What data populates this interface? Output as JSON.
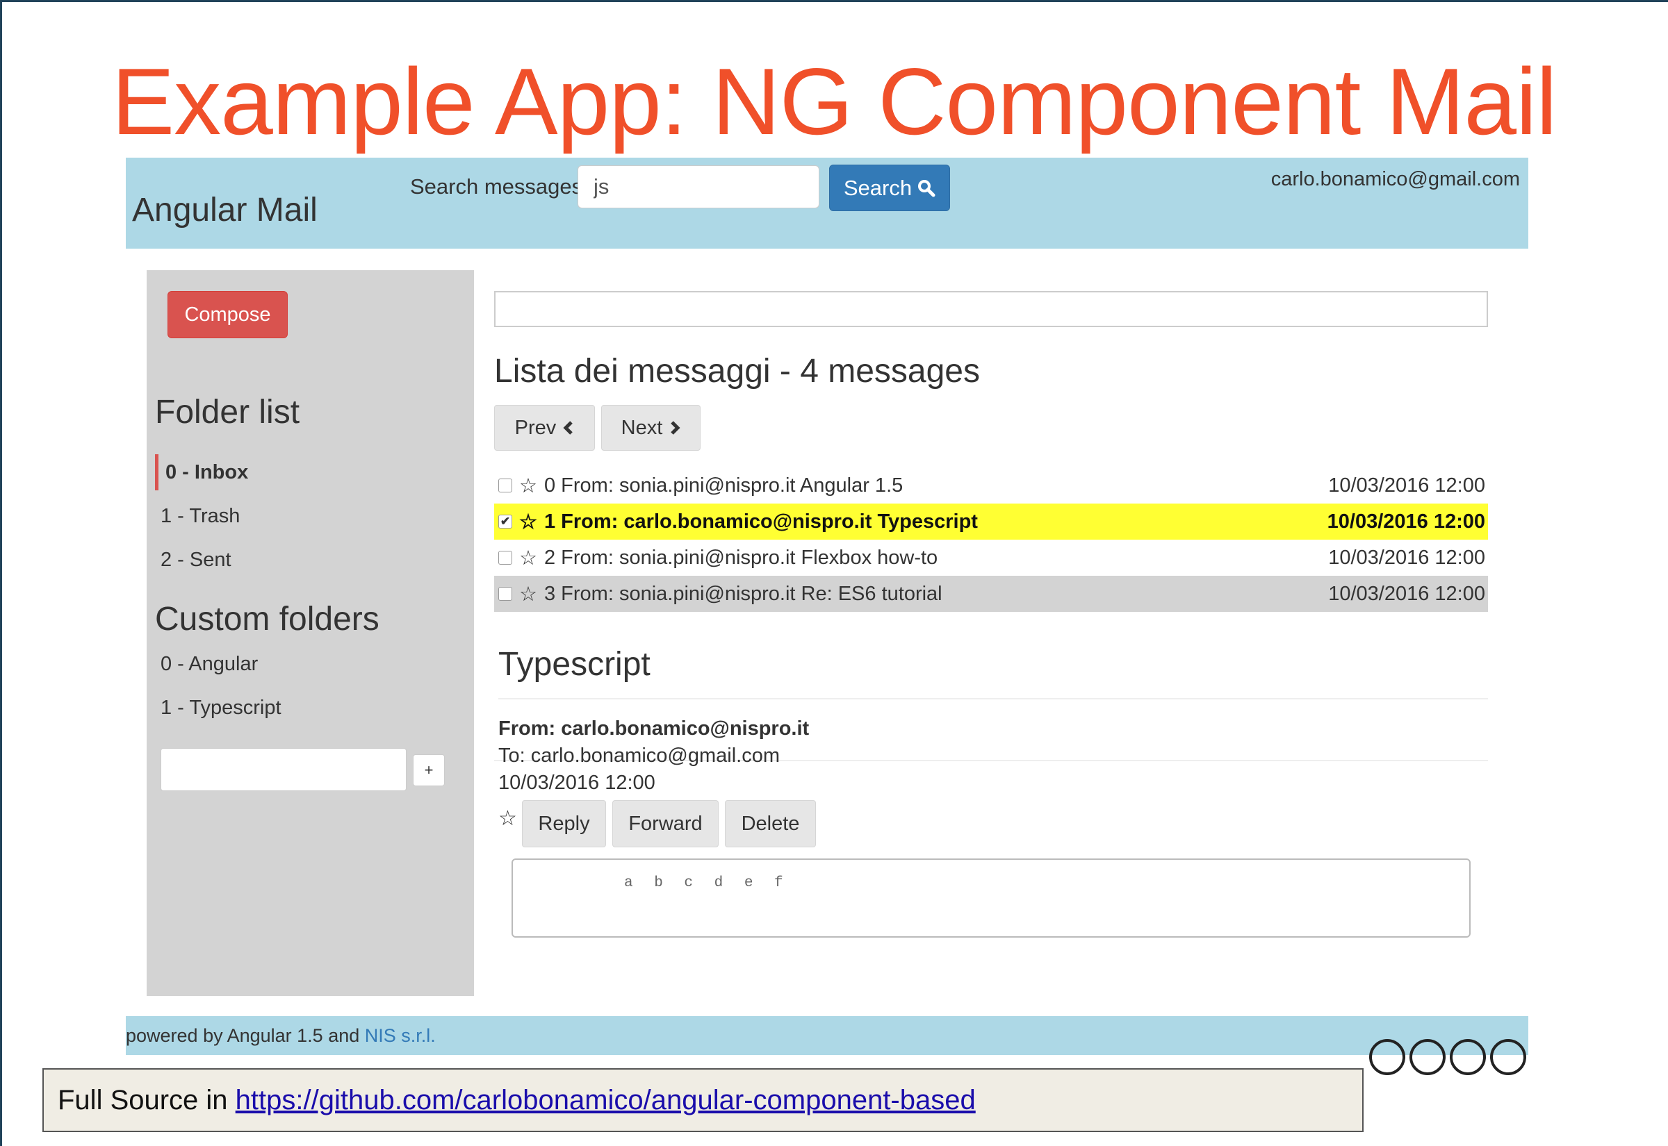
{
  "slide": {
    "title": "Example App: NG Component Mail",
    "source_prefix": "Full Source in ",
    "source_link": "https://github.com/carlobonamico/angular-component-based"
  },
  "navbar": {
    "brand": "Angular Mail",
    "search_label": "Search messages:",
    "search_value": "js",
    "search_button": "Search",
    "user_email": "carlo.bonamico@gmail.com"
  },
  "sidebar": {
    "compose_label": "Compose",
    "folder_heading": "Folder list",
    "folders": [
      {
        "label": "0 - Inbox",
        "active": true
      },
      {
        "label": "1 - Trash",
        "active": false
      },
      {
        "label": "2 - Sent",
        "active": false
      }
    ],
    "custom_heading": "Custom folders",
    "custom_folders": [
      {
        "label": "0 - Angular"
      },
      {
        "label": "1 - Typescript"
      }
    ],
    "add_folder_label": "+"
  },
  "list": {
    "title": "Lista dei messaggi - 4 messages",
    "prev_label": "Prev",
    "next_label": "Next",
    "messages": [
      {
        "text": "0 From: sonia.pini@nispro.it Angular 1.5",
        "date": "10/03/2016 12:00",
        "checked": false,
        "state": "normal"
      },
      {
        "text": "1 From: carlo.bonamico@nispro.it Typescript",
        "date": "10/03/2016 12:00",
        "checked": true,
        "state": "selected"
      },
      {
        "text": "2 From: sonia.pini@nispro.it Flexbox how-to",
        "date": "10/03/2016 12:00",
        "checked": false,
        "state": "normal"
      },
      {
        "text": "3 From: sonia.pini@nispro.it Re: ES6 tutorial",
        "date": "10/03/2016 12:00",
        "checked": false,
        "state": "hover"
      }
    ]
  },
  "detail": {
    "subject": "Typescript",
    "from": "From: carlo.bonamico@nispro.it",
    "to": "To: carlo.bonamico@gmail.com",
    "date": "10/03/2016 12:00",
    "reply_label": "Reply",
    "forward_label": "Forward",
    "delete_label": "Delete",
    "body": "a b c d e f"
  },
  "footer": {
    "prefix": "powered by Angular 1.5 and ",
    "link": "NIS s.r.l."
  },
  "colors": {
    "title": "#f0502a",
    "navbar": "#add8e6",
    "sidebar": "#d3d3d3",
    "compose": "#d9534f",
    "search_button": "#337ab7",
    "selected_row": "#ffff33"
  },
  "icons": {
    "search": "magnifier-icon",
    "prev": "chevron-left-icon",
    "next": "chevron-right-icon",
    "star": "star-outline-icon"
  }
}
